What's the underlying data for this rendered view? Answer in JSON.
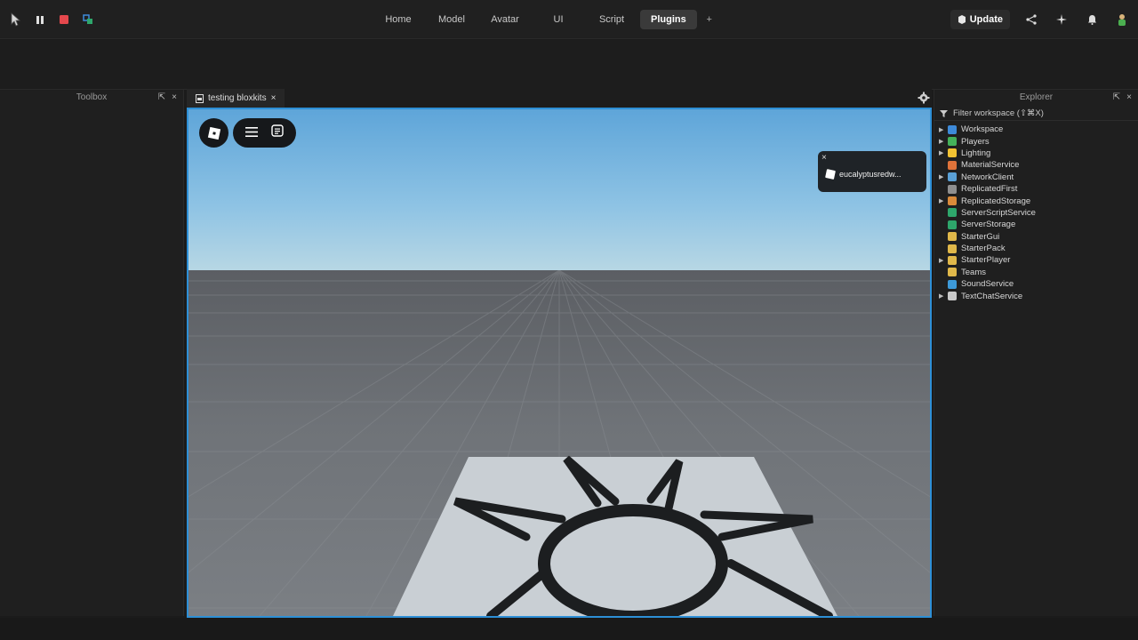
{
  "topbar": {
    "tabs": [
      "Home",
      "Model",
      "Avatar",
      "UI",
      "Script",
      "Plugins",
      "+"
    ],
    "active_tab": "Plugins",
    "update_label": "Update"
  },
  "toolbox": {
    "title": "Toolbox"
  },
  "document_tab": {
    "title": "testing bloxkits",
    "close": "×"
  },
  "toast": {
    "text": "eucalyptusredw...",
    "close": "×"
  },
  "explorer": {
    "title": "Explorer",
    "filter_placeholder": "Filter workspace (⇧⌘X)",
    "items": [
      {
        "label": "Workspace",
        "expandable": true,
        "color": "#3d8ad9"
      },
      {
        "label": "Players",
        "expandable": true,
        "color": "#44b15a"
      },
      {
        "label": "Lighting",
        "expandable": true,
        "color": "#f2c232"
      },
      {
        "label": "MaterialService",
        "expandable": false,
        "color": "#e0733a"
      },
      {
        "label": "NetworkClient",
        "expandable": true,
        "color": "#5aa0d6"
      },
      {
        "label": "ReplicatedFirst",
        "expandable": false,
        "color": "#8f8f8f"
      },
      {
        "label": "ReplicatedStorage",
        "expandable": true,
        "color": "#d98a3a"
      },
      {
        "label": "ServerScriptService",
        "expandable": false,
        "color": "#2ea66b"
      },
      {
        "label": "ServerStorage",
        "expandable": false,
        "color": "#2ea66b"
      },
      {
        "label": "StarterGui",
        "expandable": false,
        "color": "#e0b84a"
      },
      {
        "label": "StarterPack",
        "expandable": false,
        "color": "#e0b84a"
      },
      {
        "label": "StarterPlayer",
        "expandable": true,
        "color": "#e0b84a"
      },
      {
        "label": "Teams",
        "expandable": false,
        "color": "#e0b84a"
      },
      {
        "label": "SoundService",
        "expandable": false,
        "color": "#3d9ad9"
      },
      {
        "label": "TextChatService",
        "expandable": true,
        "color": "#c9c9c9"
      }
    ]
  }
}
